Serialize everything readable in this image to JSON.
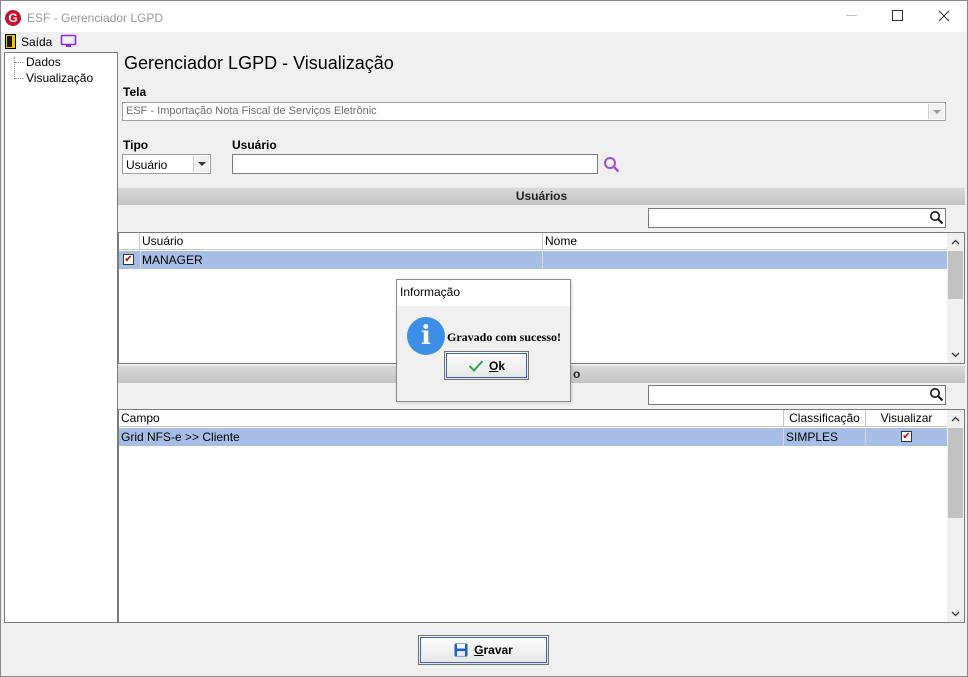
{
  "window": {
    "title": "ESF - Gerenciador LGPD",
    "logo_letter": "G"
  },
  "menu": {
    "exit_label": "Saída"
  },
  "tree": {
    "items": [
      {
        "label": "Dados"
      },
      {
        "label": "Visualização"
      }
    ]
  },
  "page": {
    "heading": "Gerenciador LGPD - Visualização"
  },
  "form": {
    "screen_label": "Tela",
    "screen_value": "ESF - Importação Nota Fiscal de Serviços Eletrônic",
    "type_label": "Tipo",
    "type_value": "Usuário",
    "user_label": "Usuário",
    "user_value": ""
  },
  "users_section": {
    "title": "Usuários",
    "search_value": "",
    "columns": [
      "Usuário",
      "Nome"
    ],
    "rows": [
      {
        "checked": true,
        "usuario": "MANAGER",
        "nome": ""
      }
    ]
  },
  "fields_section": {
    "title_visible_fragment": "o",
    "search_value": "",
    "columns": [
      "Campo",
      "Classificação",
      "Visualizar"
    ],
    "rows": [
      {
        "campo": "Grid NFS-e >> Cliente",
        "classificacao": "SIMPLES",
        "visualizar": true
      }
    ]
  },
  "dialog": {
    "title": "Informação",
    "message": "Gravado com sucesso!",
    "ok_mnemonic": "O",
    "ok_rest": "k"
  },
  "save_button": {
    "mnemonic": "G",
    "rest": "ravar"
  },
  "colors": {
    "selection": "#a6bde6",
    "search_icon_purple": "#9b4fd6",
    "info_blue": "#3c8ee6",
    "logo_red": "#c8102e"
  }
}
